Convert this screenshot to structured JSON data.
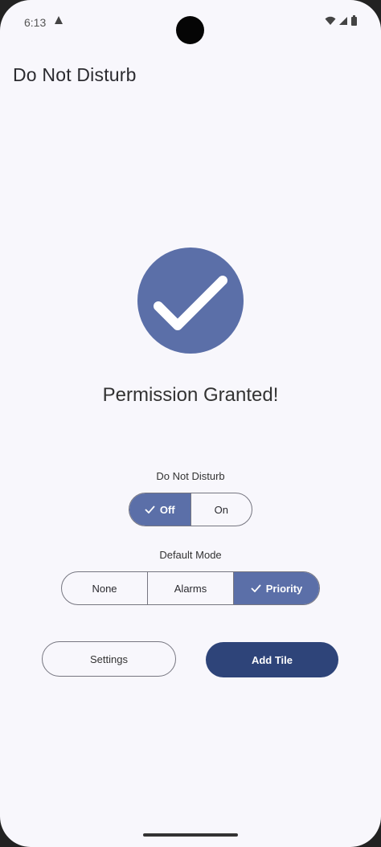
{
  "status_bar": {
    "time": "6:13",
    "alert_icon": "warning-icon",
    "right_icons": [
      "wifi-icon",
      "signal-icon",
      "battery-icon"
    ]
  },
  "app": {
    "title": "Do Not Disturb"
  },
  "permission": {
    "icon": "check-icon",
    "message": "Permission Granted!"
  },
  "dnd": {
    "label": "Do Not Disturb",
    "options": [
      {
        "label": "Off",
        "selected": true
      },
      {
        "label": "On",
        "selected": false
      }
    ]
  },
  "default_mode": {
    "label": "Default Mode",
    "options": [
      {
        "label": "None",
        "selected": false
      },
      {
        "label": "Alarms",
        "selected": false
      },
      {
        "label": "Priority",
        "selected": true
      }
    ]
  },
  "actions": {
    "settings_label": "Settings",
    "add_tile_label": "Add Tile"
  },
  "colors": {
    "accent": "#5b6fa8",
    "primary_button": "#2e4479",
    "background": "#f8f7fc"
  }
}
